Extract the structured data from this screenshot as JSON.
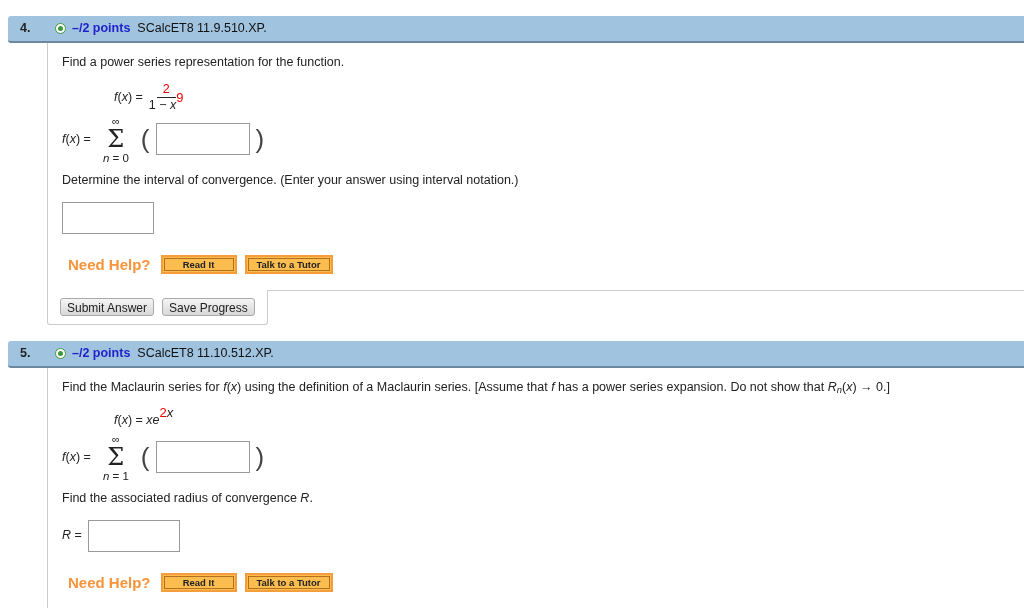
{
  "questions": [
    {
      "number": "4.",
      "points": "–/2 points",
      "code": "SCalcET8 11.9.510.XP.",
      "parts": [
        {
          "kind": "text",
          "text": "Find a power series representation for the function."
        },
        {
          "kind": "fraction",
          "lhs": "*f*(*x*) =",
          "numerator": "2",
          "denominator": "1 − *x*$^{9}$"
        },
        {
          "kind": "sum",
          "lhs": "*f*(*x*) =",
          "upper": "∞",
          "symbol": "Σ",
          "lower": "*n* = 0",
          "open": "(",
          "close": ")"
        },
        {
          "kind": "text",
          "text": "Determine the interval of convergence. (Enter your answer using interval notation.)"
        },
        {
          "kind": "field"
        },
        {
          "kind": "help",
          "label": "Need Help?",
          "buttons": [
            "Read It",
            "Talk to a Tutor"
          ]
        }
      ],
      "submit": [
        "Submit Answer",
        "Save Progress"
      ]
    },
    {
      "number": "5.",
      "points": "–/2 points",
      "code": "SCalcET8 11.10.512.XP.",
      "parts": [
        {
          "kind": "text",
          "text": "Find the Maclaurin series for *f*(*x*) using the definition of a Maclaurin series. [Assume that *f* has a power series expansion. Do not show that  *R*$_{n}$(*x*) → 0.]"
        },
        {
          "kind": "formula",
          "text": "*f*(*x*) = *xe*",
          "exponent_value": "2",
          "exponent_var": "x"
        },
        {
          "kind": "sum",
          "lhs": "*f*(*x*) =",
          "upper": "∞",
          "symbol": "Σ",
          "lower": "*n* = 1",
          "open": "(",
          "close": ")"
        },
        {
          "kind": "text",
          "text": "Find the associated radius of convergence *R*."
        },
        {
          "kind": "field",
          "label": "*R* ="
        },
        {
          "kind": "help",
          "label": "Need Help?",
          "buttons": [
            "Read It",
            "Talk to a Tutor"
          ]
        }
      ]
    }
  ]
}
